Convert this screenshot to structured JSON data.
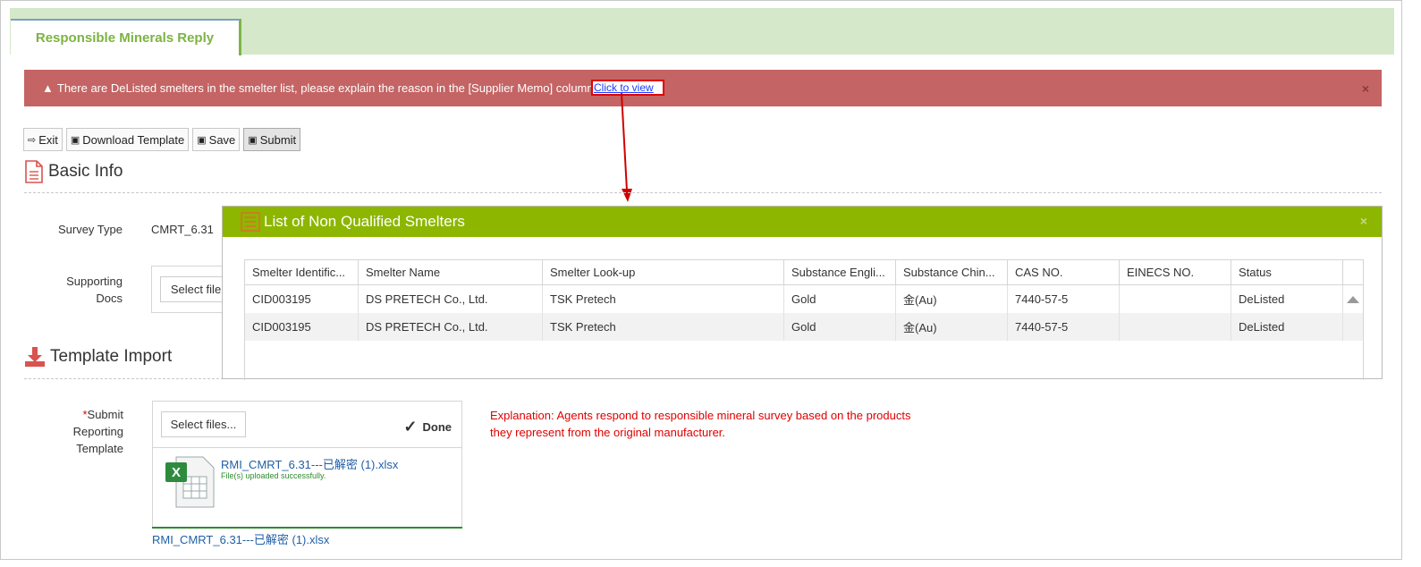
{
  "tab": {
    "label": "Responsible Minerals Reply"
  },
  "alert": {
    "message": "There are DeListed smelters in the smelter list, please explain the reason in the [Supplier Memo] column",
    "link": "Click to view",
    "close": "×"
  },
  "toolbar": {
    "exit": "Exit",
    "download_template": "Download Template",
    "save": "Save",
    "submit": "Submit"
  },
  "basic_info": {
    "title": "Basic Info",
    "survey_type_label": "Survey Type",
    "survey_type_value": "CMRT_6.31",
    "supporting_docs_label": "Supporting Docs",
    "select_files": "Select file"
  },
  "template_import": {
    "title": "Template Import",
    "required_mark": "*",
    "submit_label": "Submit Reporting Template",
    "select_files": "Select files...",
    "done": "Done",
    "file_name": "RMI_CMRT_6.31---已解密 (1).xlsx",
    "upload_status": "File(s) uploaded successfully.",
    "file_link": "RMI_CMRT_6.31---已解密 (1).xlsx",
    "explanation": "Explanation: Agents respond to responsible mineral survey based on the products they represent from the original manufacturer."
  },
  "modal": {
    "title": "List of Non Qualified Smelters",
    "close": "×",
    "columns": [
      "Smelter Identific...",
      "Smelter Name",
      "Smelter Look-up",
      "Substance Engli...",
      "Substance Chin...",
      "CAS NO.",
      "EINECS NO.",
      "Status"
    ],
    "rows": [
      [
        "CID003195",
        "DS PRETECH Co., Ltd.",
        "TSK Pretech",
        "Gold",
        "金(Au)",
        "7440-57-5",
        "",
        "DeListed"
      ],
      [
        "CID003195",
        "DS PRETECH Co., Ltd.",
        "TSK Pretech",
        "Gold",
        "金(Au)",
        "7440-57-5",
        "",
        "DeListed"
      ]
    ]
  },
  "colors": {
    "accent_green": "#8db600",
    "tab_green": "#7cb342",
    "alert_red": "#c46464",
    "explain_red": "#e00000",
    "link_blue": "#1f5fa6"
  }
}
